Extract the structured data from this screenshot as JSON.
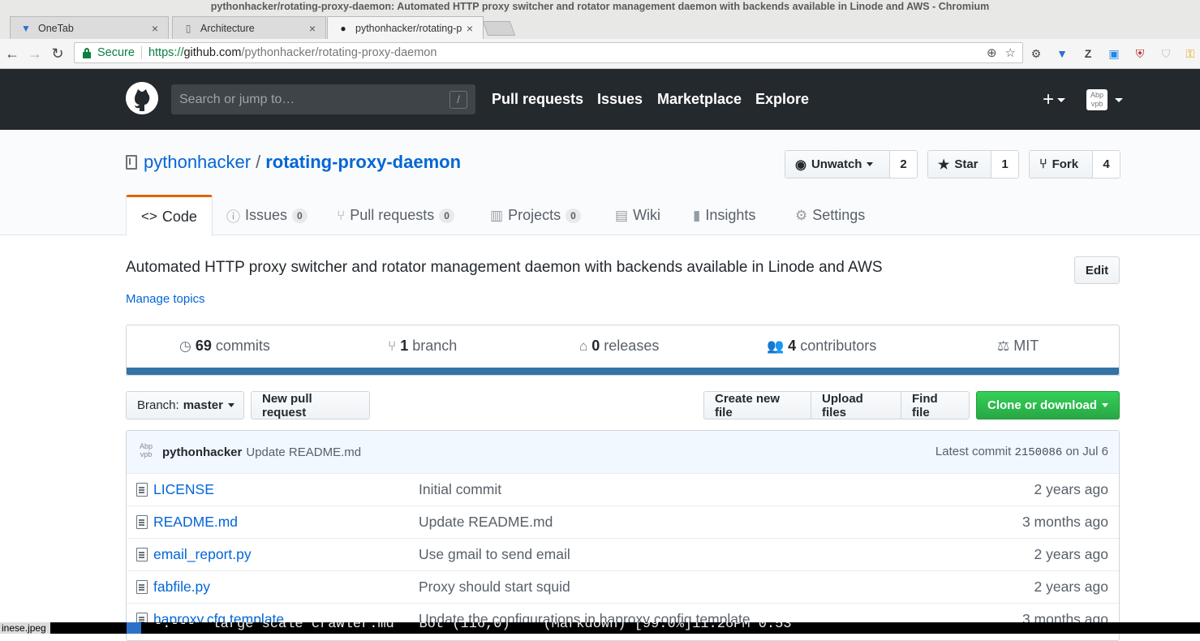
{
  "window": {
    "title": "pythonhacker/rotating-proxy-daemon: Automated HTTP proxy switcher and rotator management daemon with backends available in Linode and AWS - Chromium"
  },
  "tabs": [
    {
      "label": "OneTab",
      "icon": "onetab-icon"
    },
    {
      "label": "Architecture",
      "icon": "page-icon"
    },
    {
      "label": "pythonhacker/rotating-p",
      "icon": "github-icon",
      "active": true
    }
  ],
  "addressbar": {
    "secure_label": "Secure",
    "url_scheme": "https://",
    "url_host": "github.com",
    "url_path": "/pythonhacker/rotating-proxy-daemon"
  },
  "header": {
    "search_placeholder": "Search or jump to…",
    "search_key": "/",
    "nav": [
      "Pull requests",
      "Issues",
      "Marketplace",
      "Explore"
    ],
    "plus": "+",
    "avatar_text": "Abp vpb"
  },
  "repo": {
    "owner": "pythonhacker",
    "separator": "/",
    "name": "rotating-proxy-daemon",
    "watch": {
      "label": "Unwatch",
      "count": "2"
    },
    "star": {
      "label": "Star",
      "count": "1"
    },
    "fork": {
      "label": "Fork",
      "count": "4"
    }
  },
  "repo_tabs": [
    {
      "label": "Code",
      "icon": "<>",
      "selected": true
    },
    {
      "label": "Issues",
      "icon": "!",
      "count": "0"
    },
    {
      "label": "Pull requests",
      "icon": "⑂",
      "count": "0"
    },
    {
      "label": "Projects",
      "icon": "▥",
      "count": "0"
    },
    {
      "label": "Wiki",
      "icon": "▤"
    },
    {
      "label": "Insights",
      "icon": "▮"
    },
    {
      "label": "Settings",
      "icon": "⚙"
    }
  ],
  "description": "Automated HTTP proxy switcher and rotator management daemon with backends available in Linode and AWS",
  "manage_topics": "Manage topics",
  "edit_label": "Edit",
  "summary": {
    "commits_count": "69",
    "commits_label": "commits",
    "branch_count": "1",
    "branch_label": "branch",
    "releases_count": "0",
    "releases_label": "releases",
    "contributors_count": "4",
    "contributors_label": "contributors",
    "license": "MIT",
    "language_color": "#3572a5"
  },
  "file_nav": {
    "branch_prefix": "Branch:",
    "branch_name": "master",
    "new_pr": "New pull request",
    "create_file": "Create new file",
    "upload_files": "Upload files",
    "find_file": "Find file",
    "clone": "Clone or download"
  },
  "latest_commit": {
    "author": "pythonhacker",
    "message": "Update README.md",
    "prefix": "Latest commit",
    "sha": "2150086",
    "date": "on Jul 6"
  },
  "files": [
    {
      "name": "LICENSE",
      "message": "Initial commit",
      "age": "2 years ago"
    },
    {
      "name": "README.md",
      "message": "Update README.md",
      "age": "3 months ago"
    },
    {
      "name": "email_report.py",
      "message": "Use gmail to send email",
      "age": "2 years ago"
    },
    {
      "name": "fabfile.py",
      "message": "Proxy should start squid",
      "age": "2 years ago"
    },
    {
      "name": "haproxy.cfg.template",
      "message": "Update the configurations in haproxy config template",
      "age": "3 months ago"
    }
  ],
  "terminal": {
    "left_label": "inese.jpeg",
    "status_line": "-:---  large scale crawler.md   Bot (116,0)    (Markdown) [99.0%]11:26PM 0.53"
  }
}
